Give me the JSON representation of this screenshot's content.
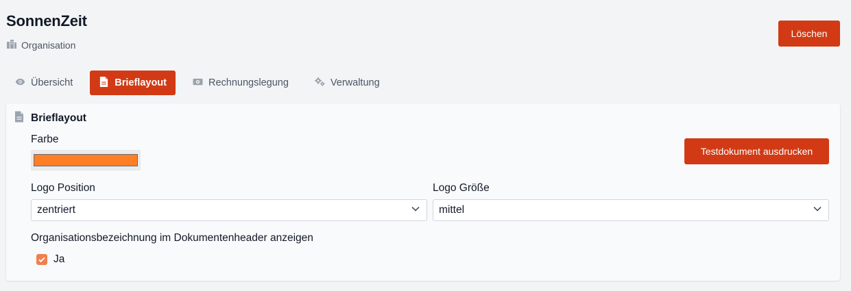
{
  "header": {
    "title": "SonnenZeit",
    "subtitle": "Organisation",
    "subtitle_icon": "building-icon",
    "delete_label": "Löschen"
  },
  "tabs": [
    {
      "label": "Übersicht",
      "icon": "eye-icon",
      "active": false
    },
    {
      "label": "Brieflayout",
      "icon": "document-icon",
      "active": true
    },
    {
      "label": "Rechnungslegung",
      "icon": "money-icon",
      "active": false
    },
    {
      "label": "Verwaltung",
      "icon": "gears-icon",
      "active": false
    }
  ],
  "panel": {
    "title": "Brieflayout",
    "title_icon": "document-icon",
    "color_label": "Farbe",
    "color_value": "#ff7f27",
    "test_button_label": "Testdokument ausdrucken",
    "logo_position_label": "Logo Position",
    "logo_position_value": "zentriert",
    "logo_size_label": "Logo Größe",
    "logo_size_value": "mittel",
    "org_header_label": "Organisationsbezeichnung im Dokumentenheader anzeigen",
    "org_header_checkbox_label": "Ja",
    "org_header_checked": true
  },
  "colors": {
    "accent": "#d13a14",
    "checkbox": "#f0804e"
  }
}
